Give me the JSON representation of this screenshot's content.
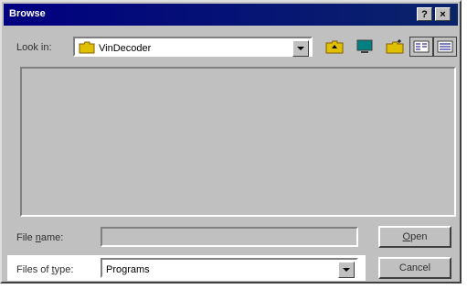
{
  "window": {
    "title": "Browse",
    "help_label": "?",
    "close_label": "×"
  },
  "look_in": {
    "label": "Look in:",
    "value": "VinDecoder"
  },
  "toolbar": [
    "up-one-level",
    "desktop",
    "create-new-folder",
    "list-view",
    "details-view"
  ],
  "file_name": {
    "label_prefix": "File ",
    "label_hotkey": "n",
    "label_suffix": "ame:",
    "value": ""
  },
  "files_of_type": {
    "label_prefix": "Files of ",
    "label_hotkey": "t",
    "label_suffix": "ype:",
    "value": "Programs"
  },
  "buttons": {
    "open_hotkey": "O",
    "open_rest": "pen",
    "cancel": "Cancel"
  },
  "colors": {
    "titlebar": "#000080",
    "face": "#c0c0c0",
    "highlight": "#ffffff",
    "shadow": "#808080"
  }
}
